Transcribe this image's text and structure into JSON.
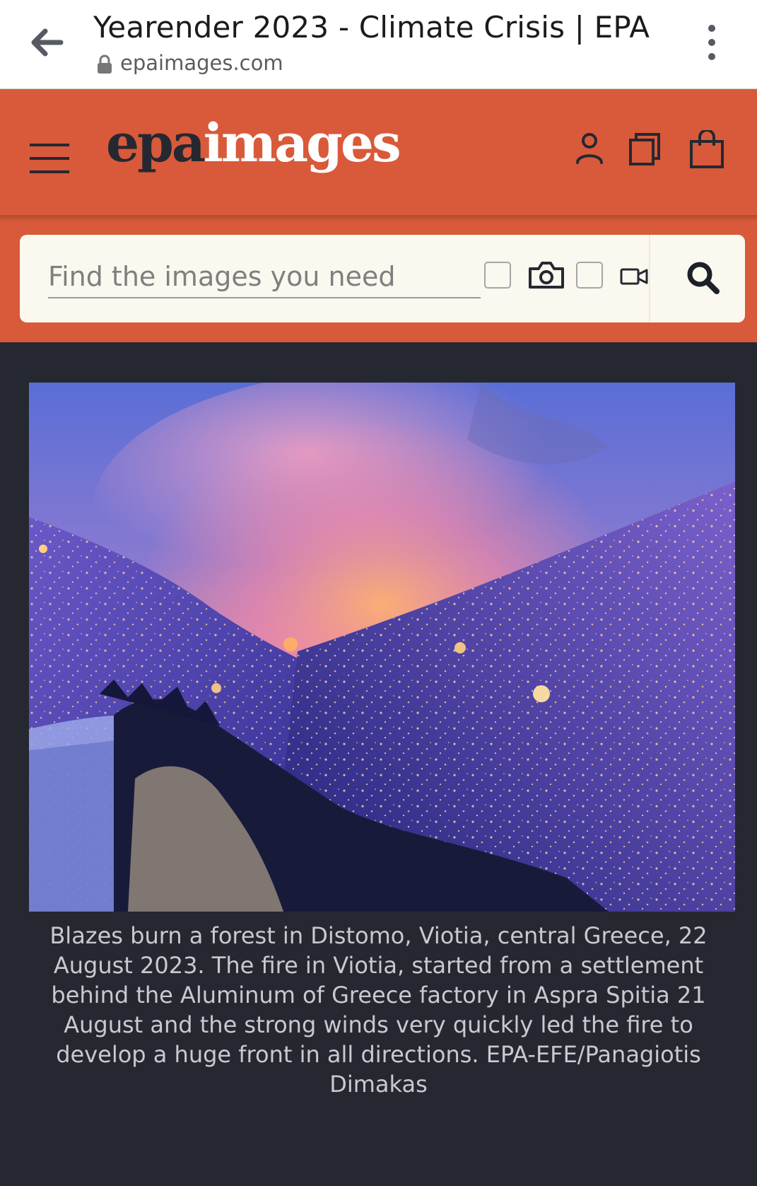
{
  "browser": {
    "tab_title": "Yearender 2023 - Climate Crisis | EPA",
    "url": "epaimages.com"
  },
  "header": {
    "logo_epa": "epa",
    "logo_images": "images"
  },
  "search": {
    "placeholder": "Find the images you need"
  },
  "photo": {
    "caption": "Blazes burn a forest in Distomo, Viotia, central Greece, 22 August 2023. The fire in Viotia, started from a settlement behind the Aluminum of Greece factory in Aspra Spitia 21 August and the strong winds very quickly led the fire to develop a huge front in all directions. EPA-EFE/Panagiotis Dimakas"
  },
  "colors": {
    "brand_orange": "#d85a3a",
    "page_background": "#262831",
    "search_background": "#fbf8ef"
  }
}
